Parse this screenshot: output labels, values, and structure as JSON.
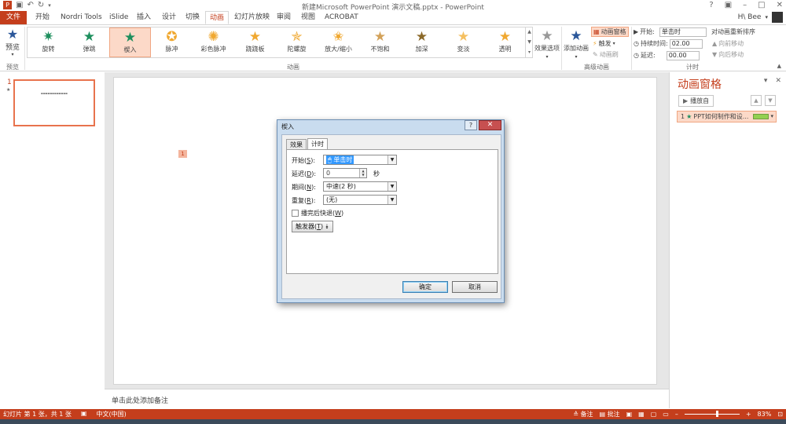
{
  "window": {
    "title": "新建Microsoft PowerPoint 演示文稿.pptx - PowerPoint",
    "help": "?",
    "user": "H\\ Bee"
  },
  "tabs": [
    {
      "label": "文件"
    },
    {
      "label": "开始"
    },
    {
      "label": "Nordri Tools"
    },
    {
      "label": "iSlide"
    },
    {
      "label": "插入"
    },
    {
      "label": "设计"
    },
    {
      "label": "切换"
    },
    {
      "label": "动画"
    },
    {
      "label": "幻灯片放映"
    },
    {
      "label": "审阅"
    },
    {
      "label": "视图"
    },
    {
      "label": "ACROBAT"
    }
  ],
  "ribbon": {
    "preview_label": "预览",
    "preview_group": "预览",
    "animation_group": "动画",
    "advanced_group": "高级动画",
    "timing_group": "计时",
    "effects": [
      {
        "label": "旋转",
        "color": "#1e8f5e"
      },
      {
        "label": "弹跳",
        "color": "#1e8f5e"
      },
      {
        "label": "楔入",
        "color": "#1e8f5e"
      },
      {
        "label": "脉冲",
        "color": "#f0a830"
      },
      {
        "label": "彩色脉冲",
        "color": "#f0a830"
      },
      {
        "label": "跷跷板",
        "color": "#f0a830"
      },
      {
        "label": "陀螺旋",
        "color": "#f0a830"
      },
      {
        "label": "放大/缩小",
        "color": "#f0a830"
      },
      {
        "label": "不饱和",
        "color": "#f0a830"
      },
      {
        "label": "加深",
        "color": "#f0a830"
      },
      {
        "label": "变淡",
        "color": "#f0a830"
      },
      {
        "label": "透明",
        "color": "#f0a830"
      }
    ],
    "effect_options": "效果选项",
    "add_animation": "添加动画",
    "animation_pane": "动画窗格",
    "trigger": "触发",
    "animation_painter": "动画刷",
    "start_label": "开始:",
    "start_value": "单击时",
    "duration_label": "持续时间:",
    "duration_value": "02.00",
    "delay_label": "延迟:",
    "delay_value": "00.00",
    "reorder_label": "对动画重新排序",
    "move_earlier": "向前移动",
    "move_later": "向后移动"
  },
  "thumbs": {
    "slide_number": "1",
    "slide_star": "★"
  },
  "slide": {
    "anim_tag": "1"
  },
  "notes": {
    "placeholder": "单击此处添加备注"
  },
  "anim_pane": {
    "title": "动画窗格",
    "play_label": "播放自",
    "item_index": "1",
    "item_label": "PPT如何制作和设..."
  },
  "status": {
    "slide_info": "幻灯片 第 1 张，共 1 张",
    "language": "中文(中国)",
    "notes_btn": "备注",
    "comments_btn": "批注",
    "zoom": "83%",
    "zoom_fraction": 0.6
  },
  "dialog": {
    "title": "楔入",
    "help": "?",
    "close": "✕",
    "tab_effect": "效果",
    "tab_timing": "计时",
    "start_label": "开始(",
    "start_key": "S",
    "start_value": "单击时",
    "delay_label": "延迟(",
    "delay_key": "D",
    "delay_value": "0",
    "delay_unit": "秒",
    "period_label": "期间(",
    "period_key": "N",
    "period_value": "中速(2 秒)",
    "repeat_label": "重复(",
    "repeat_key": "R",
    "repeat_value": "(无)",
    "rewind_label": "播完后快退(",
    "rewind_key": "W",
    "trigger_label": "触发器(",
    "trigger_key": "T",
    "ok": "确定",
    "cancel": "取消"
  }
}
